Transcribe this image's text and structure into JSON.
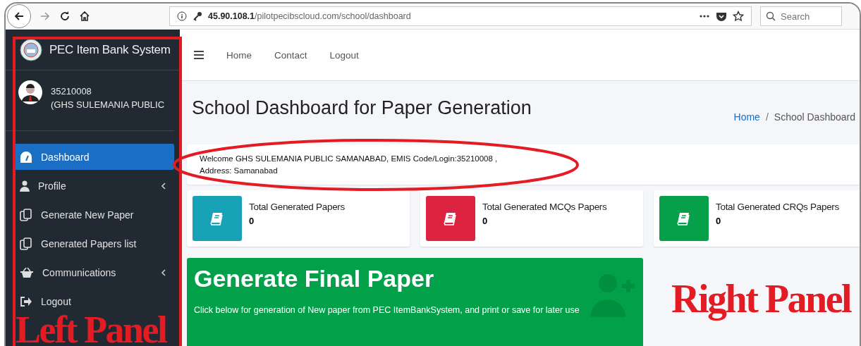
{
  "browser": {
    "url_host": "45.90.108.1",
    "url_path": "/pilotpecibscloud.com/school/dashboard",
    "search_placeholder": "Search"
  },
  "sidebar": {
    "brand": "PEC Item Bank System",
    "user_id": "35210008",
    "user_school": "(GHS SULEMANIA PUBLIC",
    "items": [
      {
        "kind": "dashboard",
        "label": "Dashboard",
        "selected": true,
        "submenu": false
      },
      {
        "kind": "profile",
        "label": "Profile",
        "selected": false,
        "submenu": true
      },
      {
        "kind": "paper",
        "label": "Generate New Paper",
        "selected": false,
        "submenu": false
      },
      {
        "kind": "paper",
        "label": "Generated Papers list",
        "selected": false,
        "submenu": false
      },
      {
        "kind": "basket",
        "label": "Communications",
        "selected": false,
        "submenu": true
      },
      {
        "kind": "logout",
        "label": "Logout",
        "selected": false,
        "submenu": false
      }
    ]
  },
  "topnav": [
    "Home",
    "Contact",
    "Logout"
  ],
  "page_title": "School Dashboard for Paper Generation",
  "breadcrumb": {
    "separator": "/",
    "items": [
      {
        "label": "Home",
        "link": true
      },
      {
        "label": "School Dashboard",
        "link": false
      }
    ]
  },
  "welcome": [
    "Welcome GHS SULEMANIA PUBLIC SAMANABAD, EMIS Code/Login:35210008 ,",
    "Address: Samanabad"
  ],
  "stats": [
    {
      "label": "Total Generated Papers",
      "value": "0",
      "color": "#17a2b8"
    },
    {
      "label": "Total Generated MCQs Papers",
      "value": "0",
      "color": "#dc2340"
    },
    {
      "label": "Total Generated CRQs Papers",
      "value": "0",
      "color": "#06a04a"
    }
  ],
  "banner": {
    "title": "Generate Final Paper",
    "text": "Click below for generation of New paper from PEC ItemBankSystem, and print or save for later use"
  },
  "annotations": {
    "left_label": "Left Panel",
    "right_label": "Right Panel"
  }
}
